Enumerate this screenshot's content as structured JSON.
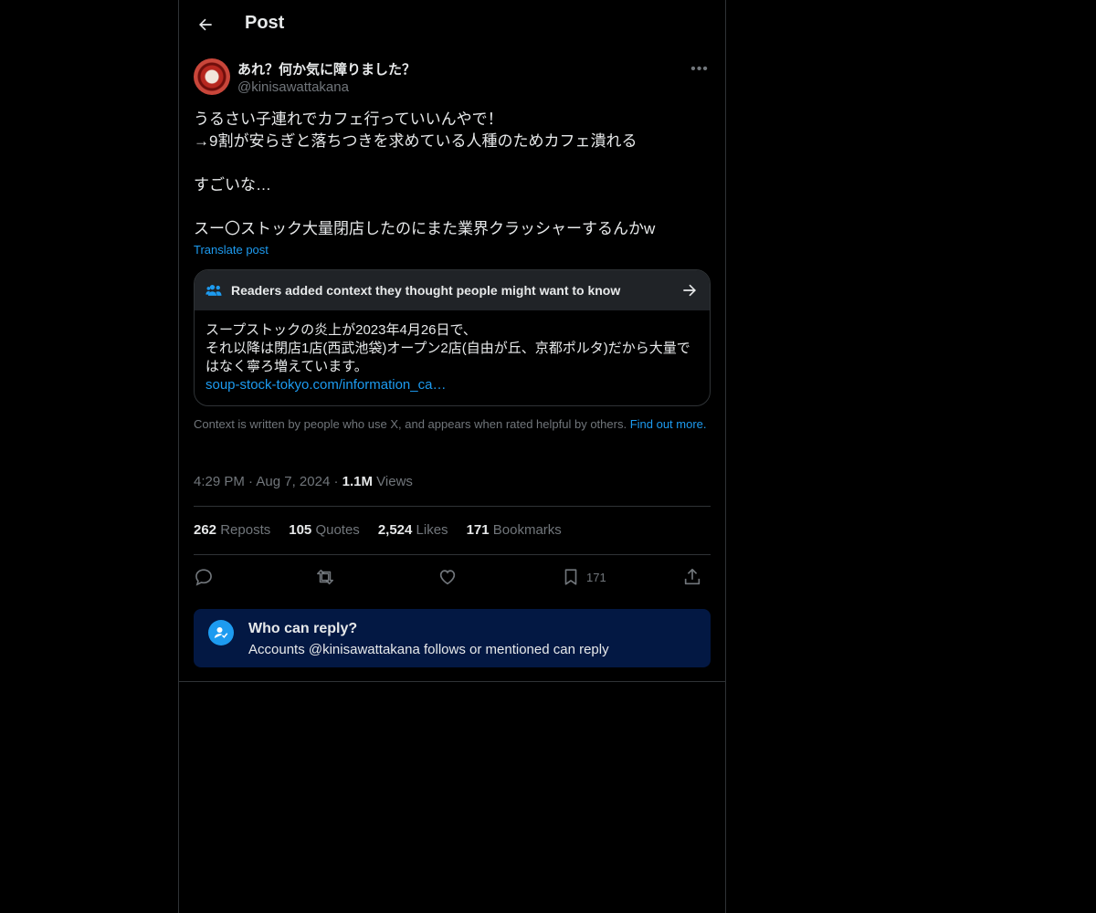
{
  "header": {
    "title": "Post"
  },
  "post": {
    "display_name": "あれ？何か気に障りました？",
    "handle": "@kinisawattakana",
    "text": "うるさい子連れでカフェ行っていいんやで！\n→9割が安らぎと落ちつきを求めている人種のためカフェ潰れる\n\nすごいな…\n\nスー〇ストック大量閉店したのにまた業界クラッシャーするんかw",
    "translate_label": "Translate post"
  },
  "note": {
    "title": "Readers added context they thought people might want to know",
    "body": "スープストックの炎上が2023年4月26日で、\nそれ以降は閉店1店(西武池袋)オープン2店(自由が丘、京都ポルタ)だから大量ではなく寧ろ増えています。",
    "link": "soup-stock-tokyo.com/information_ca…",
    "context_text": "Context is written by people who use X, and appears when rated helpful by others.",
    "find_out_more": "Find out more."
  },
  "meta": {
    "time": "4:29 PM",
    "date": "Aug 7, 2024",
    "views_count": "1.1M",
    "views_label": "Views"
  },
  "stats": {
    "reposts_count": "262",
    "reposts_label": "Reposts",
    "quotes_count": "105",
    "quotes_label": "Quotes",
    "likes_count": "2,524",
    "likes_label": "Likes",
    "bookmarks_count": "171",
    "bookmarks_label": "Bookmarks"
  },
  "actions": {
    "bookmark_count": "171"
  },
  "reply_restriction": {
    "title": "Who can reply?",
    "subtitle": "Accounts @kinisawattakana follows or mentioned can reply"
  },
  "colors": {
    "accent": "#1d9bf0",
    "secondary_text": "#71767b",
    "reply_box_bg": "#031843",
    "note_header_bg": "#202327"
  }
}
